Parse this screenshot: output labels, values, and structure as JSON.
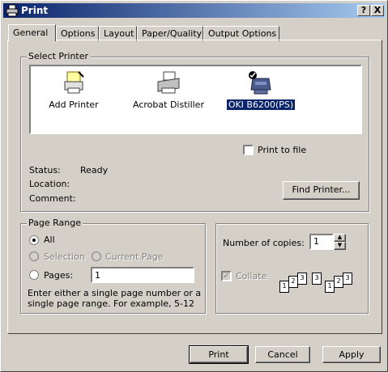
{
  "window": {
    "title": "Print",
    "help_button": "?",
    "close_button": "X"
  },
  "tabs": [
    {
      "label": "General"
    },
    {
      "label": "Options"
    },
    {
      "label": "Layout"
    },
    {
      "label": "Paper/Quality"
    },
    {
      "label": "Output Options"
    }
  ],
  "select_printer": {
    "group_label": "Select Printer",
    "printers": [
      {
        "name": "Add Printer",
        "icon": "add-printer-icon"
      },
      {
        "name": "Acrobat Distiller",
        "icon": "printer-icon"
      },
      {
        "name": "OKI B6200(PS)",
        "icon": "default-printer-icon",
        "selected": true
      }
    ],
    "print_to_file_label": "Print to file",
    "status_label": "Status:",
    "status_value": "Ready",
    "location_label": "Location:",
    "comment_label": "Comment:",
    "find_printer_label": "Find Printer..."
  },
  "page_range": {
    "group_label": "Page Range",
    "all_label": "All",
    "selection_label": "Selection",
    "current_page_label": "Current Page",
    "pages_label": "Pages:",
    "pages_value": "1",
    "help_text": "Enter either a single page number or a single page range.  For example, 5-12"
  },
  "copies": {
    "label": "Number of copies:",
    "value": "1",
    "collate_label": "Collate"
  },
  "buttons": {
    "print": "Print",
    "cancel": "Cancel",
    "apply": "Apply"
  },
  "colors": {
    "title_start": "#0a246a",
    "title_end": "#a6caf0",
    "face": "#d4d0c8"
  }
}
